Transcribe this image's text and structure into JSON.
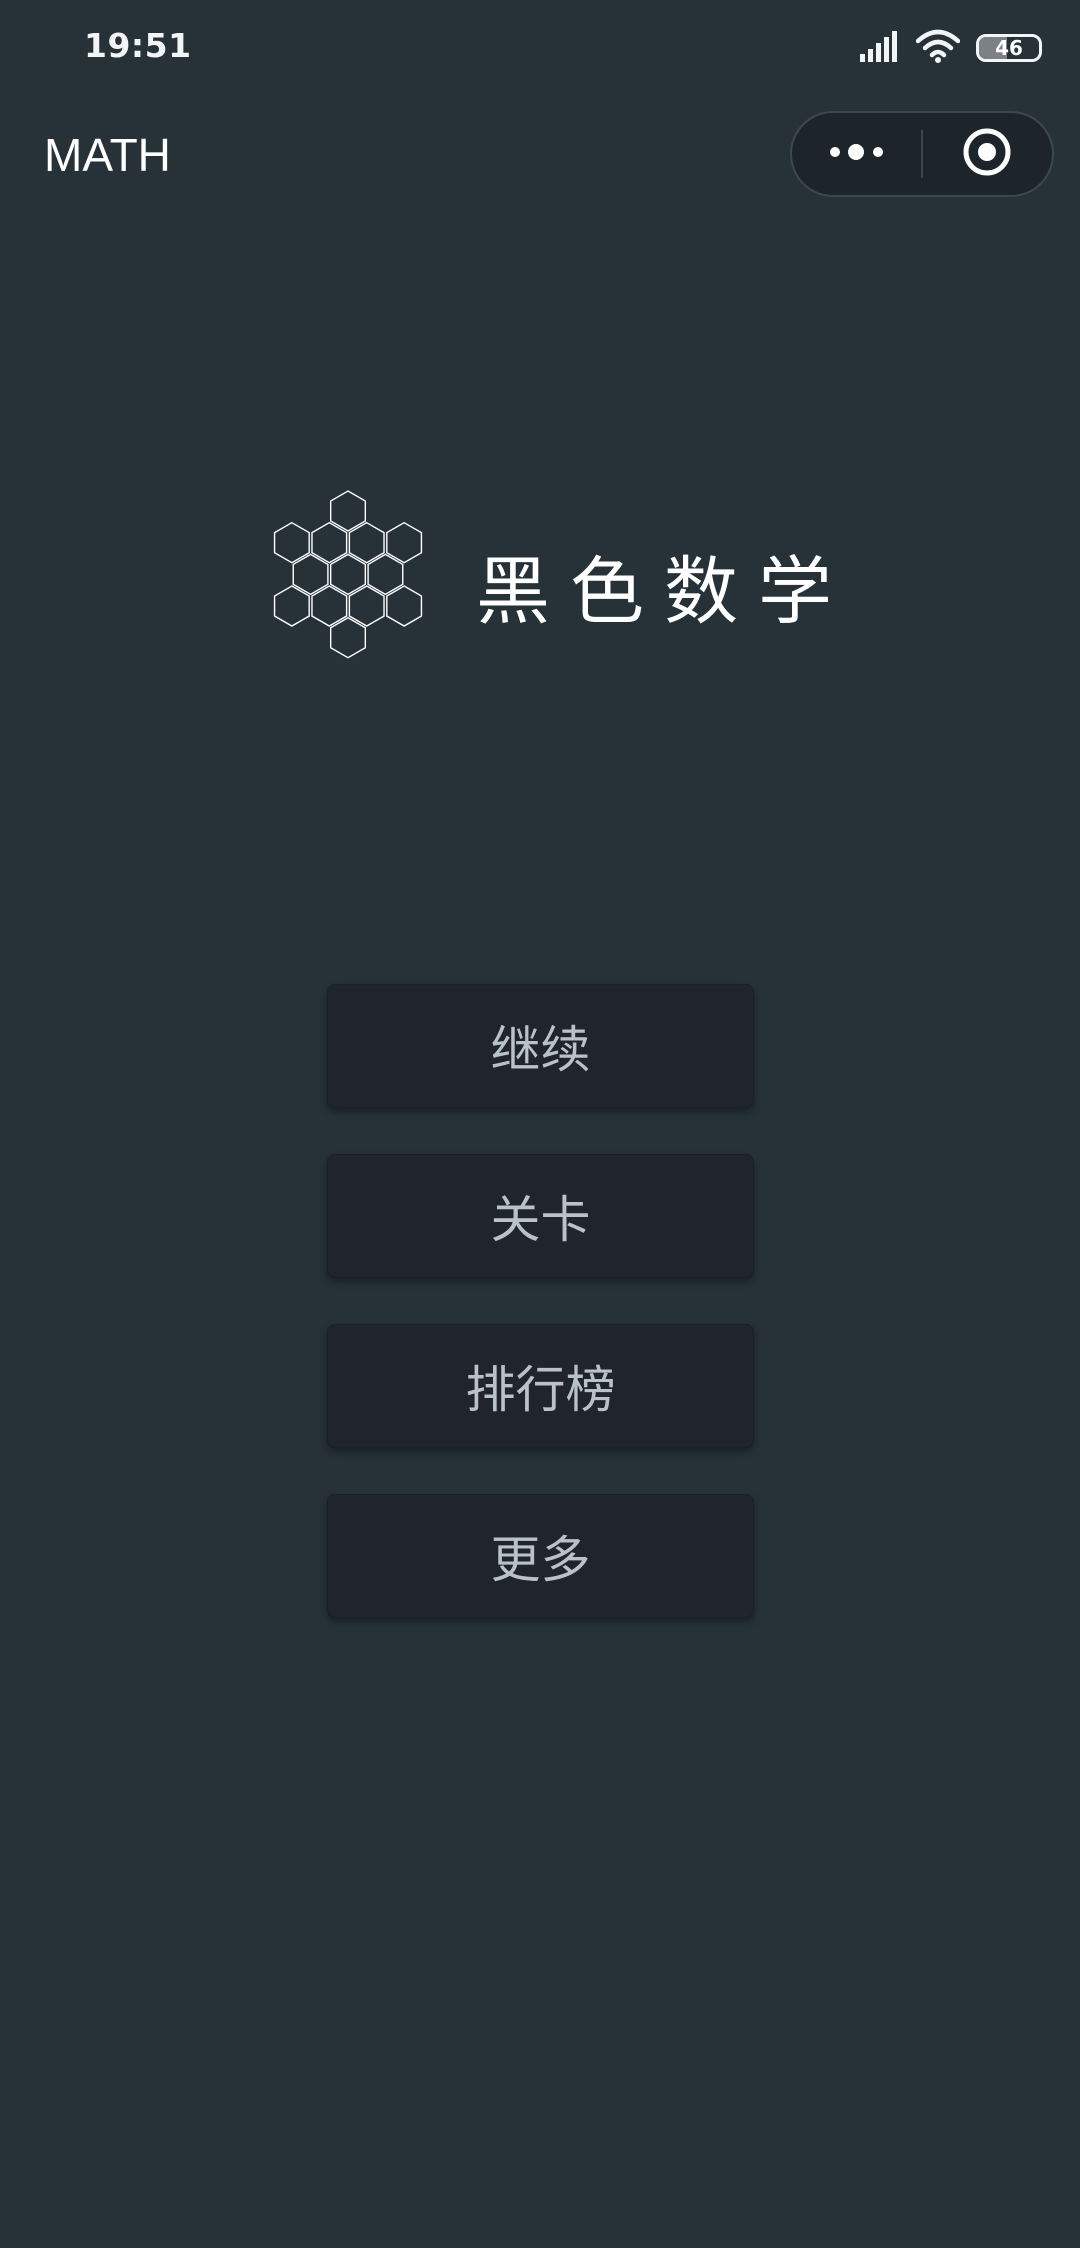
{
  "status_bar": {
    "time": "19:51",
    "battery": "46",
    "battery_level": 0.46,
    "icons": [
      "signal-icon",
      "wifi-icon",
      "battery-icon"
    ]
  },
  "nav": {
    "title": "MATH",
    "capsule_icons": [
      "more-dots-icon",
      "close-target-icon"
    ]
  },
  "logo": {
    "icon": "hexagon-cluster-icon",
    "title": "黑色数学"
  },
  "menu": {
    "items": [
      {
        "label": "继续"
      },
      {
        "label": "关卡"
      },
      {
        "label": "排行榜"
      },
      {
        "label": "更多"
      }
    ]
  },
  "colors": {
    "background": "#263238",
    "button_bg": "#1f252b",
    "button_text": "#b9c3c7"
  }
}
